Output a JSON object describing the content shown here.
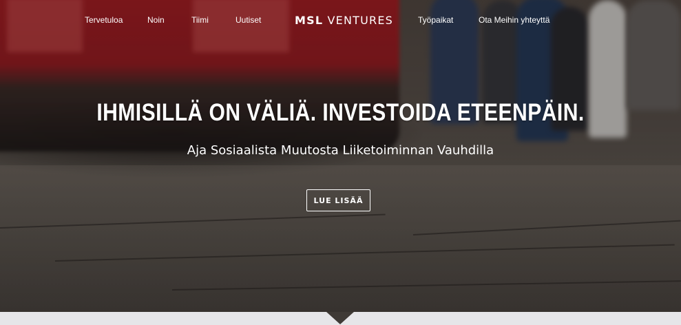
{
  "nav": {
    "items": [
      {
        "label": "Tervetuloa"
      },
      {
        "label": "Noin"
      },
      {
        "label": "Tiimi"
      },
      {
        "label": "Uutiset"
      },
      {
        "label": "Työpaikat"
      },
      {
        "label": "Ota Meihin yhteyttä"
      }
    ],
    "brand_bold": "MSL",
    "brand_rest": " VENTURES"
  },
  "hero": {
    "headline": "IHMISILLÄ ON VÄLIÄ. INVESTOIDA ETEENPÄIN.",
    "subheadline": "Aja Sosiaalista Muutosta Liiketoiminnan Vauhdilla",
    "cta_label": "LUE LISÄÄ"
  },
  "colors": {
    "tram_red": "#b21c23",
    "text": "#ffffff",
    "bottom_bar": "#e6e6e9"
  },
  "icons": {
    "scroll_indicator": "down-triangle-icon"
  }
}
